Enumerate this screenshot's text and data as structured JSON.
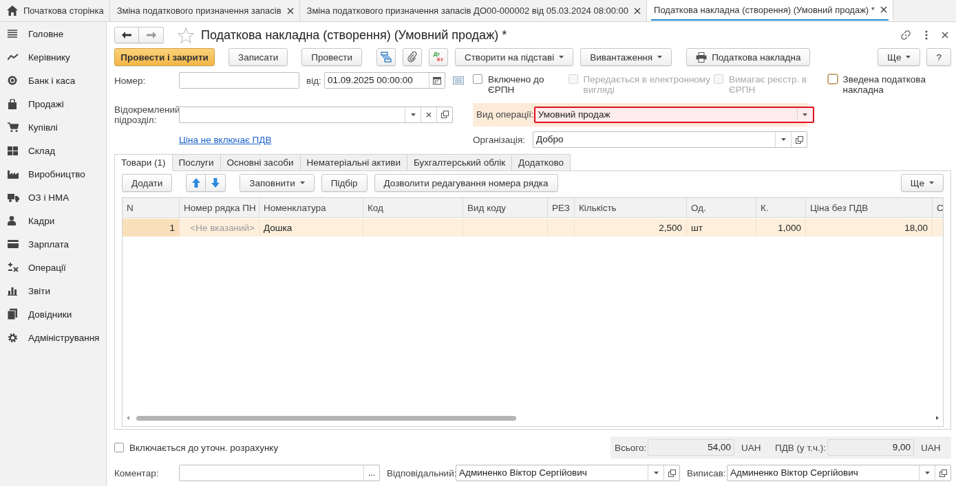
{
  "open_tabs": [
    {
      "kind": "home",
      "label": "Початкова сторінка",
      "selected": false,
      "closable": false
    },
    {
      "kind": "doc",
      "label": "Зміна податкового призначення запасів",
      "selected": false,
      "closable": true
    },
    {
      "kind": "doc",
      "label": "Зміна податкового призначення запасів ДО00-000002 від 05.03.2024 08:00:00",
      "selected": false,
      "closable": true
    },
    {
      "kind": "doc",
      "label": "Податкова накладна (створення) (Умовний продаж) *",
      "selected": true,
      "closable": true
    }
  ],
  "sidebar": {
    "items": [
      {
        "label": "Головне"
      },
      {
        "label": "Керівнику"
      },
      {
        "label": "Банк і каса"
      },
      {
        "label": "Продажі"
      },
      {
        "label": "Купівлі"
      },
      {
        "label": "Склад"
      },
      {
        "label": "Виробництво"
      },
      {
        "label": "ОЗ і НМА"
      },
      {
        "label": "Кадри"
      },
      {
        "label": "Зарплата"
      },
      {
        "label": "Операції"
      },
      {
        "label": "Звіти"
      },
      {
        "label": "Довідники"
      },
      {
        "label": "Адміністрування"
      }
    ]
  },
  "document": {
    "title": "Податкова накладна (створення) (Умовний продаж) *"
  },
  "toolbar_left": [
    {
      "kind": "primary",
      "label": "Провести і закрити"
    },
    {
      "kind": "button",
      "label": "Записати"
    },
    {
      "kind": "button",
      "label": "Провести"
    },
    {
      "kind": "structure"
    },
    {
      "kind": "attach"
    },
    {
      "kind": "dtkt",
      "top": "Дт",
      "bottom": "Кт"
    },
    {
      "kind": "dropdown",
      "label": "Створити на підставі"
    },
    {
      "kind": "dropdown",
      "label": "Вивантаження"
    },
    {
      "kind": "print",
      "label": "Податкова накладна"
    }
  ],
  "toolbar_right": [
    {
      "kind": "dropdown",
      "label": "Ще"
    },
    {
      "kind": "button",
      "label": "?"
    }
  ],
  "number": {
    "label": "Номер:"
  },
  "date": {
    "label": "від:",
    "value": "01.09.2025 00:00:00"
  },
  "flags": [
    {
      "label": "Включено до ЄРПН",
      "checked": false,
      "disabled": false,
      "focused": false
    },
    {
      "label": "Передається в електронному вигляді",
      "checked": false,
      "disabled": true,
      "focused": false
    },
    {
      "label": "Вимагає реєстр. в ЄРПН",
      "checked": false,
      "disabled": true,
      "focused": false
    },
    {
      "label": "Зведена податкова накладна",
      "checked": false,
      "disabled": false,
      "focused": true
    }
  ],
  "branch": {
    "label": "Відокремлений підрозділ:"
  },
  "operation": {
    "label": "Вид операції:",
    "value": "Умовний продаж",
    "highlighted": true
  },
  "price_link": "Ціна не включає ПДВ",
  "organization": {
    "label": "Організація:",
    "value": "Добро"
  },
  "section_tabs": [
    {
      "label": "Товари (1)",
      "selected": true
    },
    {
      "label": "Послуги",
      "selected": false
    },
    {
      "label": "Основні засоби",
      "selected": false
    },
    {
      "label": "Нематеріальні активи",
      "selected": false
    },
    {
      "label": "Бухгалтерський облік",
      "selected": false
    },
    {
      "label": "Додатково",
      "selected": false
    }
  ],
  "table_toolbar": {
    "left": [
      {
        "kind": "button",
        "label": "Додати"
      },
      {
        "kind": "up"
      },
      {
        "kind": "down"
      },
      {
        "kind": "dropdown",
        "label": "Заповнити"
      },
      {
        "kind": "button",
        "label": "Підбір"
      },
      {
        "kind": "button",
        "label": "Дозволити редагування номера рядка"
      }
    ],
    "right": [
      {
        "kind": "dropdown",
        "label": "Ще"
      }
    ]
  },
  "table": {
    "columns": [
      {
        "label": "N"
      },
      {
        "label": "Номер рядка ПН"
      },
      {
        "label": "Номенклатура"
      },
      {
        "label": "Код"
      },
      {
        "label": "Вид коду"
      },
      {
        "label": "РЕЗ"
      },
      {
        "label": "Кількість"
      },
      {
        "label": "Од."
      },
      {
        "label": "К."
      },
      {
        "label": "Ціна без ПДВ"
      },
      {
        "label": "С"
      }
    ],
    "rows": [
      {
        "selected": true,
        "cells": [
          {
            "text": "1"
          },
          {
            "text": "<Не вказаний>",
            "placeholder": true
          },
          {
            "text": "Дошка"
          },
          null,
          null,
          null,
          {
            "text": "2,500"
          },
          {
            "text": "шт"
          },
          {
            "text": "1,000"
          },
          {
            "text": "18,00"
          },
          null
        ]
      }
    ]
  },
  "adjustment": {
    "label": "Включається до уточн. розрахунку",
    "checked": false
  },
  "totals": {
    "total_label": "Всього:",
    "total": "54,00",
    "total_currency": "UAH",
    "vat_label": "ПДВ (у т.ч.):",
    "vat": "9,00",
    "vat_currency": "UAH"
  },
  "comment": {
    "label": "Коментар:",
    "select_button": "..."
  },
  "responsible": {
    "label": "Відповідальний:",
    "value": "Админенко Віктор Сергійович"
  },
  "issued_by": {
    "label": "Виписав:",
    "value": "Админенко Віктор Сергійович"
  }
}
